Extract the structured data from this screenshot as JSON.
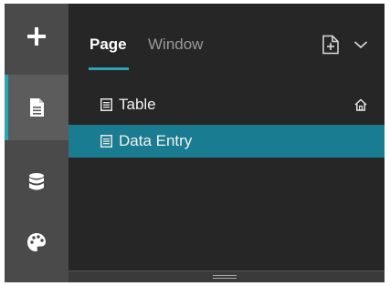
{
  "rail": {
    "items": [
      {
        "icon": "plus-icon",
        "label": ""
      },
      {
        "icon": "document-icon",
        "label": "",
        "active": true
      },
      {
        "icon": "database-icon",
        "label": ""
      },
      {
        "icon": "palette-icon",
        "label": ""
      }
    ]
  },
  "tabs": {
    "page_label": "Page",
    "window_label": "Window",
    "active": "Page"
  },
  "pages": [
    {
      "label": "Table",
      "home": true,
      "selected": false
    },
    {
      "label": "Data Entry",
      "home": false,
      "selected": true
    }
  ],
  "colors": {
    "accent": "#2aa4b5",
    "selected_row": "#1a7c90",
    "rail_bg": "#4a4a4a",
    "panel_bg": "#262626"
  }
}
